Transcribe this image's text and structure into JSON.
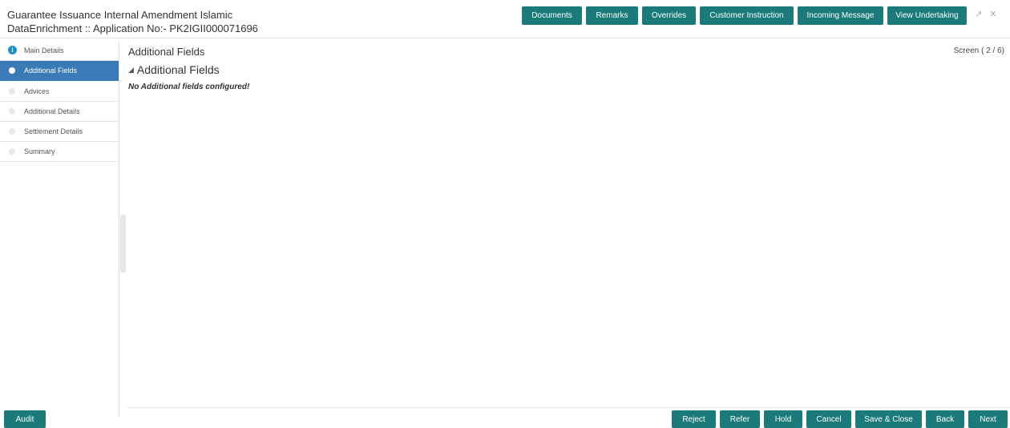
{
  "header": {
    "title": "Guarantee Issuance Internal Amendment Islamic",
    "subtitle": "DataEnrichment :: Application No:- PK2IGII000071696",
    "actions": [
      "Documents",
      "Remarks",
      "Overrides",
      "Customer Instruction",
      "Incoming Message",
      "View Undertaking"
    ],
    "window_icons": [
      "expand-icon",
      "close-icon"
    ]
  },
  "sidebar": {
    "items": [
      {
        "label": "Main Details",
        "state": "completed"
      },
      {
        "label": "Additional Fields",
        "state": "active"
      },
      {
        "label": "Advices",
        "state": "pending"
      },
      {
        "label": "Additional Details",
        "state": "pending"
      },
      {
        "label": "Settlement Details",
        "state": "pending"
      },
      {
        "label": "Summary",
        "state": "pending"
      }
    ]
  },
  "main": {
    "page_title": "Additional Fields",
    "screen_indicator": "Screen ( 2 / 6)",
    "section_title": "Additional Fields",
    "empty_message": "No Additional fields configured!"
  },
  "footer": {
    "audit": "Audit",
    "actions": [
      "Reject",
      "Refer",
      "Hold",
      "Cancel",
      "Save & Close",
      "Back",
      "Next"
    ]
  },
  "colors": {
    "button": "#1b7a7a",
    "active_nav": "#3a7bb7",
    "completed_step": "#1f8fcc"
  }
}
